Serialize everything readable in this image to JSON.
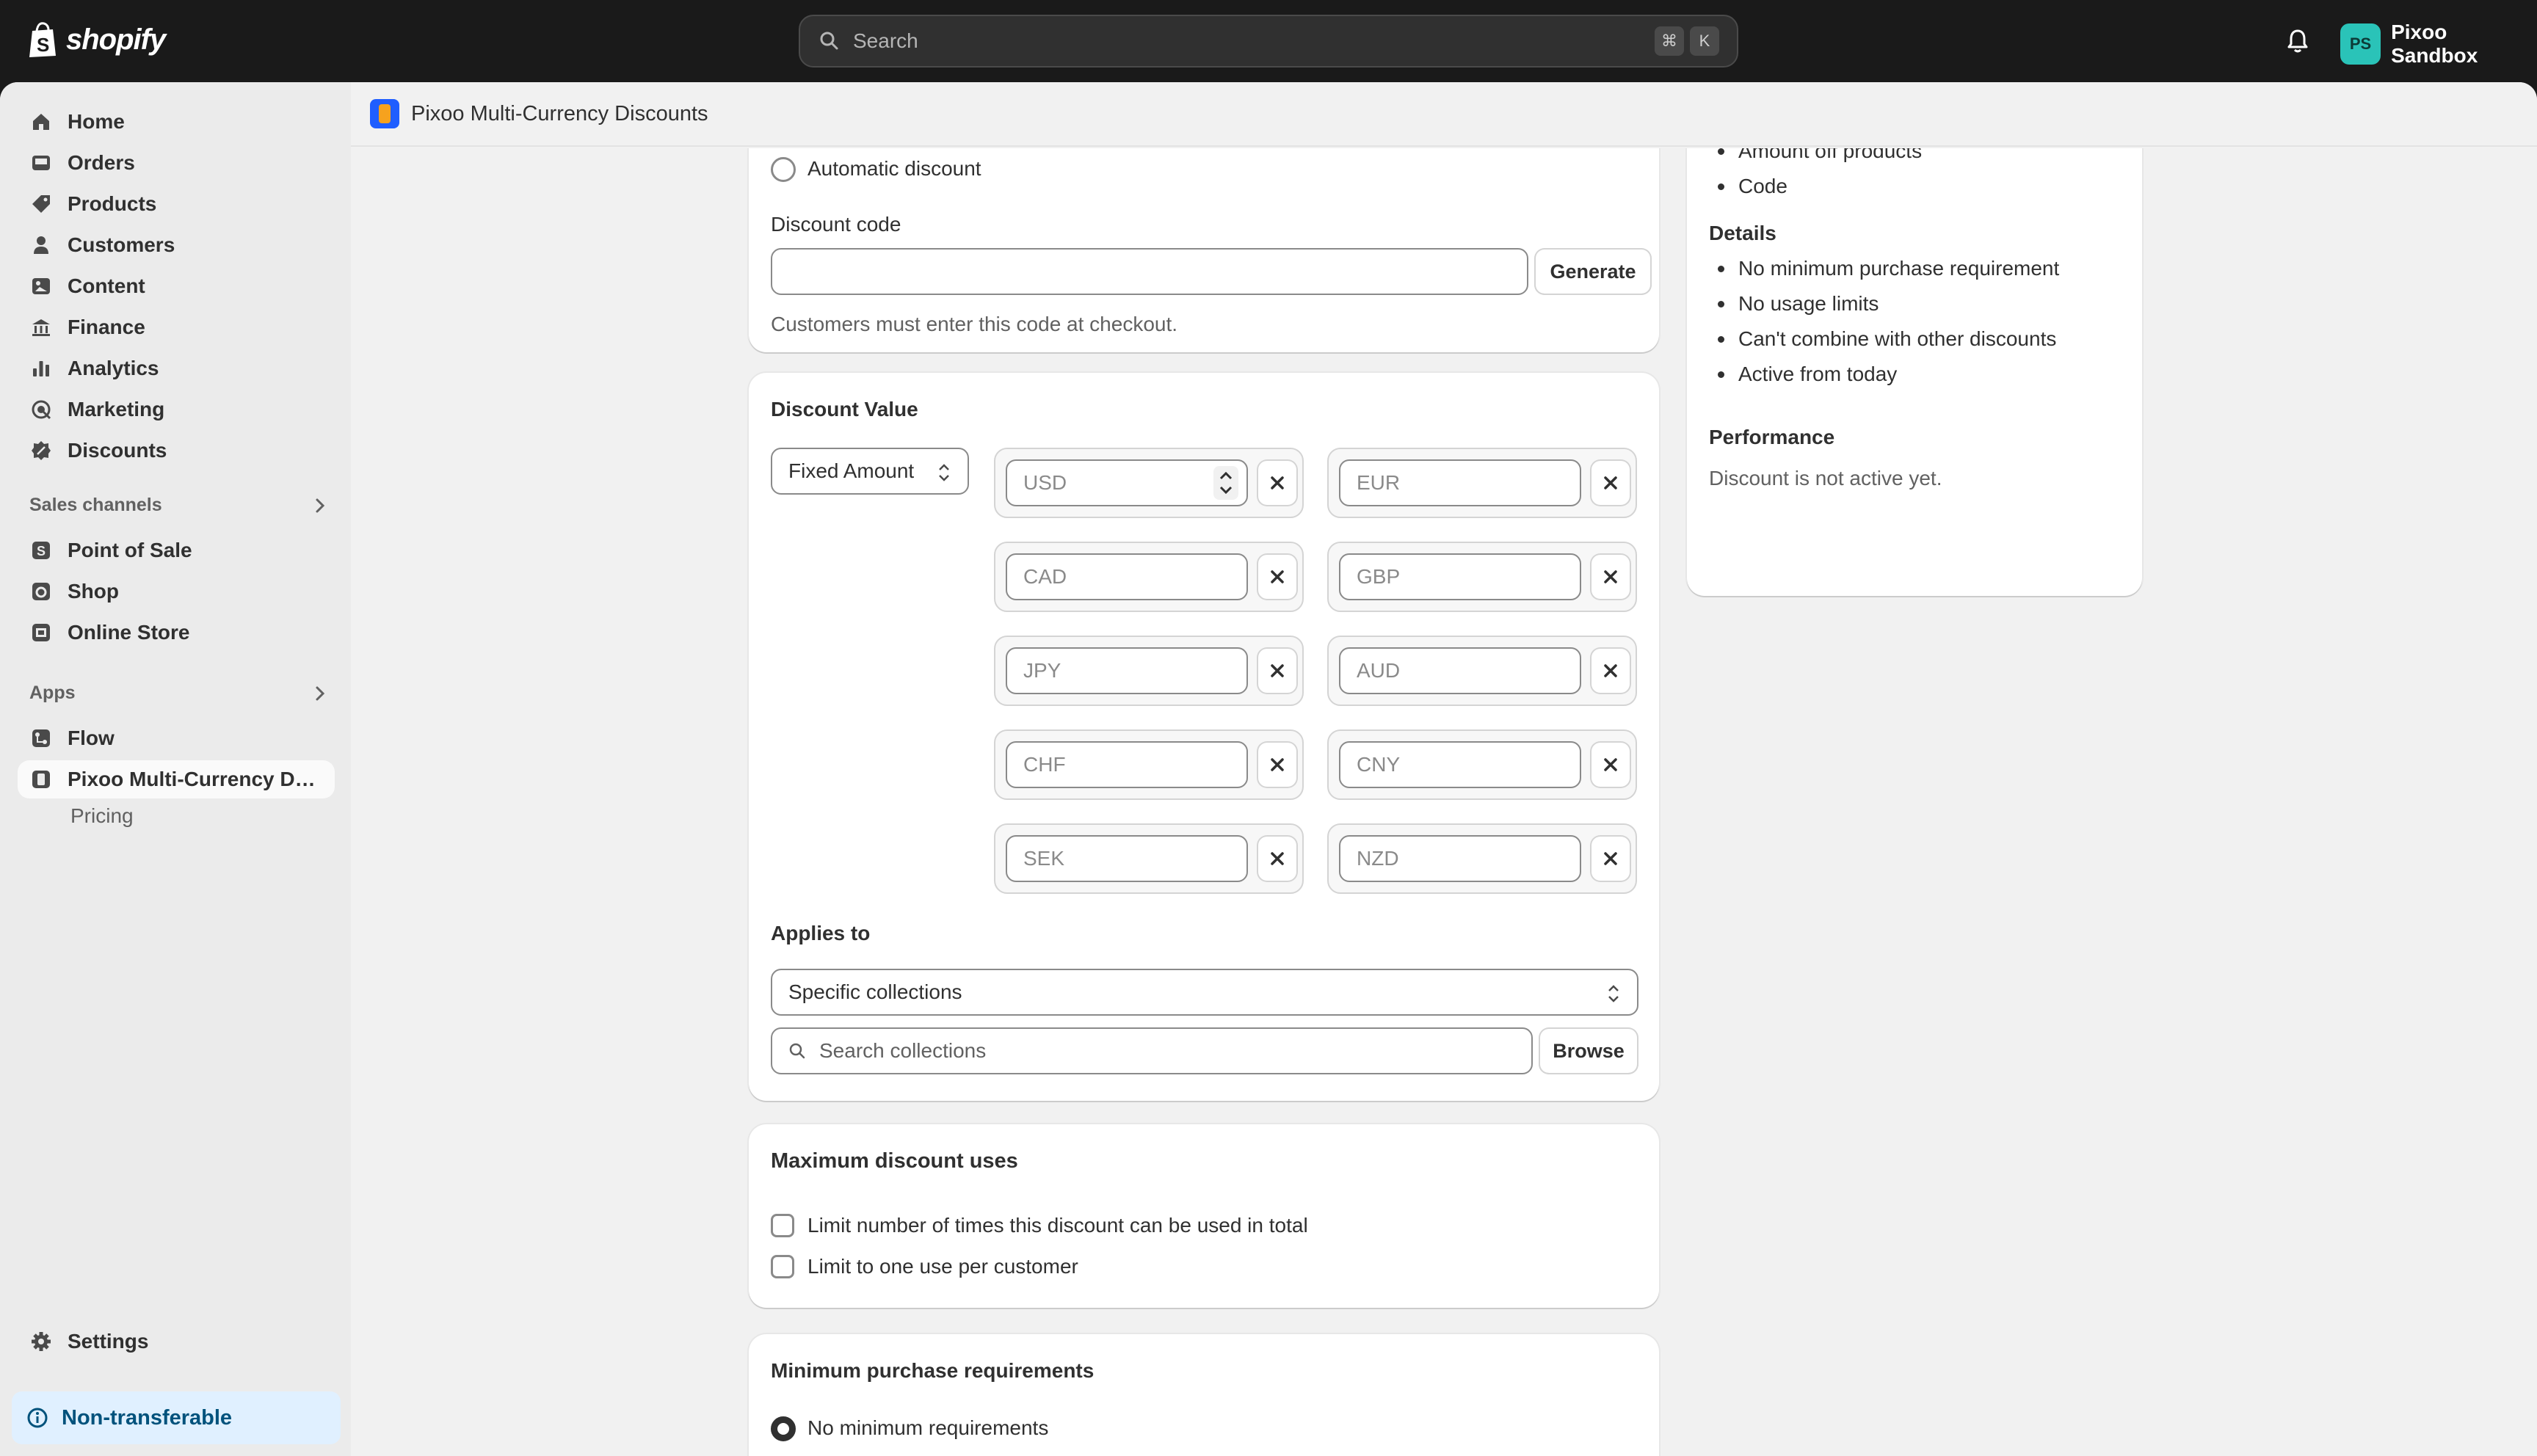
{
  "topbar": {
    "brand": "shopify",
    "search_placeholder": "Search",
    "shortcut_keys": [
      "⌘",
      "K"
    ],
    "account_initials": "PS",
    "account_name": "Pixoo Sandbox",
    "avatar_color": "#2ac3b8"
  },
  "sidebar": {
    "items": [
      {
        "label": "Home",
        "icon": "home-icon"
      },
      {
        "label": "Orders",
        "icon": "inbox-icon"
      },
      {
        "label": "Products",
        "icon": "tag-icon"
      },
      {
        "label": "Customers",
        "icon": "person-icon"
      },
      {
        "label": "Content",
        "icon": "image-icon"
      },
      {
        "label": "Finance",
        "icon": "bank-icon"
      },
      {
        "label": "Analytics",
        "icon": "bar-chart-icon"
      },
      {
        "label": "Marketing",
        "icon": "target-icon"
      },
      {
        "label": "Discounts",
        "icon": "discount-icon"
      }
    ],
    "sales_channels_header": "Sales channels",
    "sales_channels": [
      {
        "label": "Point of Sale",
        "icon": "pos-icon"
      },
      {
        "label": "Shop",
        "icon": "shop-icon"
      },
      {
        "label": "Online Store",
        "icon": "store-icon"
      }
    ],
    "apps_header": "Apps",
    "apps": [
      {
        "label": "Flow",
        "icon": "flow-icon"
      },
      {
        "label": "Pixoo Multi-Currency Dis...",
        "icon": "app-icon"
      }
    ],
    "app_sub": "Pricing",
    "settings_label": "Settings",
    "non_transferable": "Non-transferable"
  },
  "appbar": {
    "title": "Pixoo Multi-Currency Discounts",
    "icon_color": "#1f5eff"
  },
  "method_card": {
    "automatic_label": "Automatic discount",
    "code_label": "Discount code",
    "code_value": "",
    "generate_label": "Generate",
    "help_text": "Customers must enter this code at checkout."
  },
  "value_card": {
    "title": "Discount Value",
    "type_select": "Fixed Amount",
    "currencies": [
      [
        "USD",
        "EUR"
      ],
      [
        "CAD",
        "GBP"
      ],
      [
        "JPY",
        "AUD"
      ],
      [
        "CHF",
        "CNY"
      ],
      [
        "SEK",
        "NZD"
      ]
    ],
    "applies_to_label": "Applies to",
    "applies_to_select": "Specific collections",
    "search_placeholder": "Search collections",
    "browse_label": "Browse"
  },
  "max_uses_card": {
    "title": "Maximum discount uses",
    "options": [
      "Limit number of times this discount can be used in total",
      "Limit to one use per customer"
    ]
  },
  "min_req_card": {
    "title": "Minimum purchase requirements",
    "selected_option": "No minimum requirements"
  },
  "summary_card": {
    "type_items": [
      "Amount off products",
      "Code"
    ],
    "details_header": "Details",
    "details_items": [
      "No minimum purchase requirement",
      "No usage limits",
      "Can't combine with other discounts",
      "Active from today"
    ],
    "performance_header": "Performance",
    "performance_text": "Discount is not active yet."
  }
}
